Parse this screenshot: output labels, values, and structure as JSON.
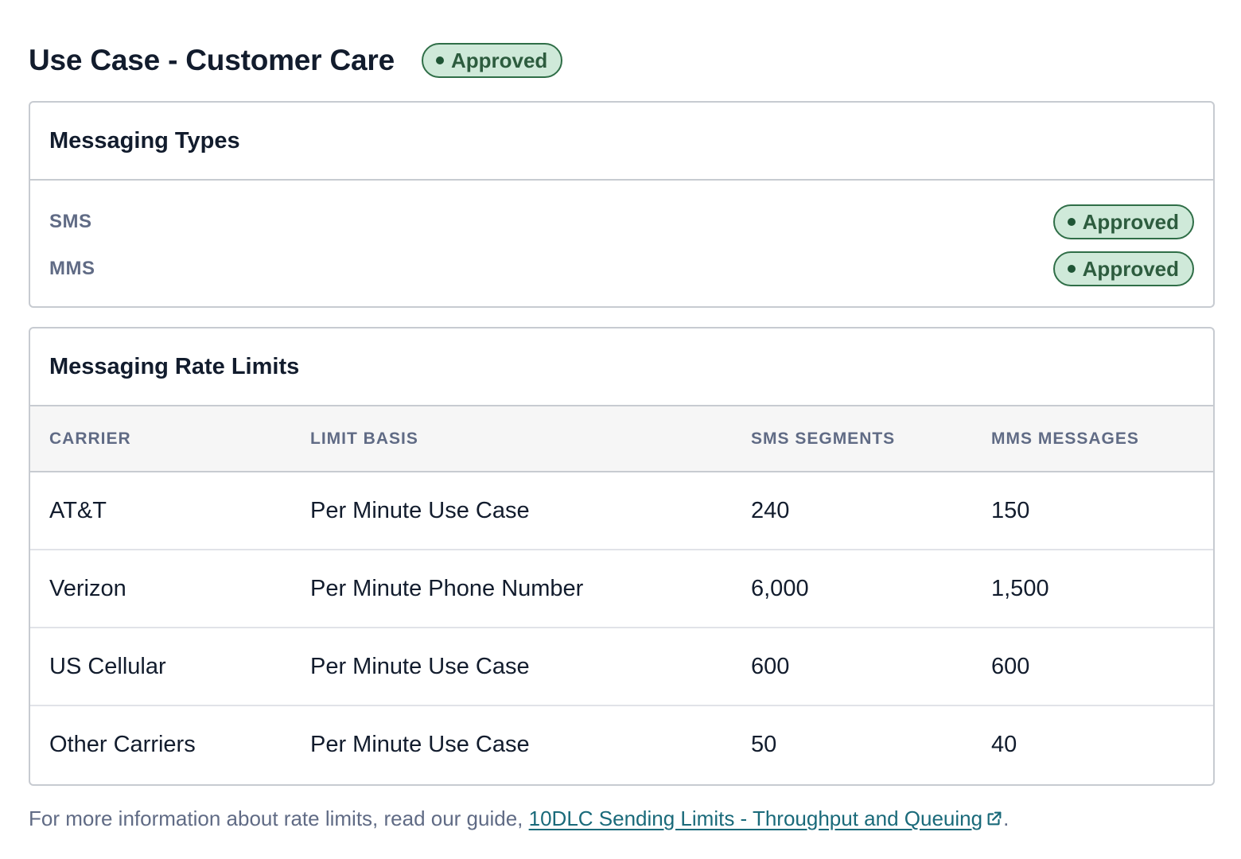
{
  "header": {
    "title": "Use Case - Customer Care",
    "status": "Approved"
  },
  "messaging_types": {
    "title": "Messaging Types",
    "items": [
      {
        "label": "SMS",
        "status": "Approved"
      },
      {
        "label": "MMS",
        "status": "Approved"
      }
    ]
  },
  "rate_limits": {
    "title": "Messaging Rate Limits",
    "columns": [
      "CARRIER",
      "LIMIT BASIS",
      "SMS SEGMENTS",
      "MMS MESSAGES"
    ],
    "rows": [
      {
        "carrier": "AT&T",
        "basis": "Per Minute Use Case",
        "sms": "240",
        "mms": "150"
      },
      {
        "carrier": "Verizon",
        "basis": "Per Minute Phone Number",
        "sms": "6,000",
        "mms": "1,500"
      },
      {
        "carrier": "US Cellular",
        "basis": "Per Minute Use Case",
        "sms": "600",
        "mms": "600"
      },
      {
        "carrier": "Other Carriers",
        "basis": "Per Minute Use Case",
        "sms": "50",
        "mms": "40"
      }
    ]
  },
  "footnote": {
    "prefix": "For more information about rate limits, read our guide, ",
    "link_text": "10DLC Sending Limits - Throughput and Queuing",
    "suffix": "."
  },
  "colors": {
    "badge_bg": "#cfe9d9",
    "badge_border": "#2f6e47",
    "link": "#1a6a7a"
  },
  "icons": {
    "status_dot": "dot-icon",
    "external_link": "external-link-icon"
  }
}
